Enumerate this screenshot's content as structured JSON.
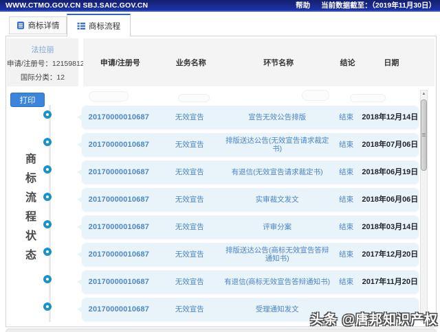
{
  "topbar": {
    "urls": "WWW.CTMO.GOV.CN SBJ.SAIC.GOV.CN",
    "help": "帮助",
    "data_cutoff": "当前数据截至：（2019年11月30日）"
  },
  "tabs": {
    "details": {
      "label": "商标详情"
    },
    "flow": {
      "label": "商标流程"
    }
  },
  "info": {
    "name": "法拉丽",
    "reg_no_line": "申请/注册号：12159812",
    "class_line": "国际分类：12"
  },
  "toolbar": {
    "print_label": "打印"
  },
  "side_title": "商标流程状态",
  "table": {
    "headers": [
      "申请/注册号",
      "业务名称",
      "环节名称",
      "结论",
      "日期"
    ],
    "rows": [
      {
        "reg_no": "20170000010687",
        "business": "无效宣告",
        "step": "宣告无效公告排版",
        "result": "结束",
        "date": "2018年12月14日"
      },
      {
        "reg_no": "20170000010687",
        "business": "无效宣告",
        "step": "排版送达公告(无效宣告请求裁定书)",
        "result": "结束",
        "date": "2018年07月06日"
      },
      {
        "reg_no": "20170000010687",
        "business": "无效宣告",
        "step": "有退信(无效宣告请求裁定书)",
        "result": "结束",
        "date": "2018年06月19日"
      },
      {
        "reg_no": "20170000010687",
        "business": "无效宣告",
        "step": "实审裁文发文",
        "result": "结束",
        "date": "2018年06月06日"
      },
      {
        "reg_no": "20170000010687",
        "business": "无效宣告",
        "step": "评审分案",
        "result": "结束",
        "date": "2018年03月14日"
      },
      {
        "reg_no": "20170000010687",
        "business": "无效宣告",
        "step": "排版送达公告(商标无效宣告答辩通知书)",
        "result": "结束",
        "date": "2017年12月20日"
      },
      {
        "reg_no": "20170000010687",
        "business": "无效宣告",
        "step": "有退信(商标无效宣告答辩通知书)",
        "result": "结束",
        "date": "2017年11月20日"
      },
      {
        "reg_no": "20170000010687",
        "business": "无效宣告",
        "step": "受理通知发文",
        "result": "",
        "date": ""
      }
    ]
  },
  "watermark": "头条 @唐邦知识产权",
  "colors": {
    "accent_blue": "#2b62c9",
    "row_bg": "#e8f3fa",
    "row_text": "#4a86c8",
    "timeline_ring": "#1b93c9",
    "print_button": "#3c85dc",
    "topbar_bg": "#1e32a8"
  }
}
